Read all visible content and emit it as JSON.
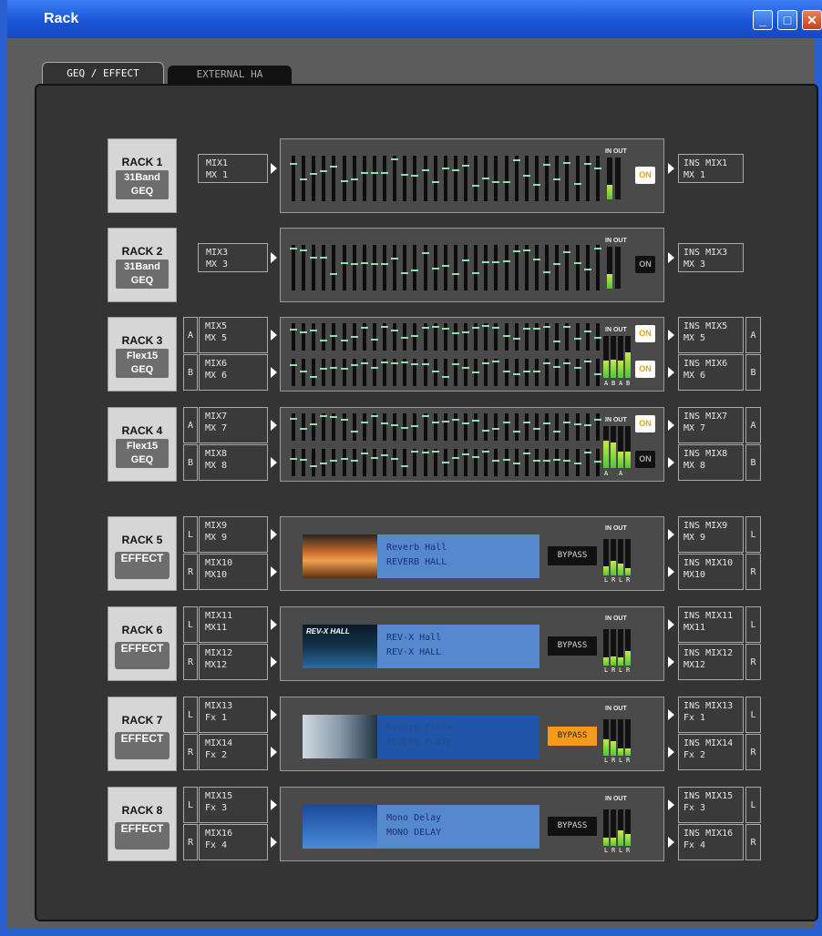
{
  "window": {
    "title": "Rack"
  },
  "tabs": [
    "GEQ / EFFECT",
    "EXTERNAL HA"
  ],
  "labels": {
    "in": "IN",
    "out": "OUT",
    "on": "ON",
    "bypass": "BYPASS"
  },
  "racks": [
    {
      "kind": "geq",
      "name": "RACK 1",
      "type": "31Band\nGEQ",
      "in": [
        [
          "MIX1",
          "MX 1"
        ]
      ],
      "out": [
        [
          "INS MIX1",
          "MX 1"
        ]
      ],
      "on": [
        true
      ]
    },
    {
      "kind": "geq",
      "name": "RACK 2",
      "type": "31Band\nGEQ",
      "in": [
        [
          "MIX3",
          "MX 3"
        ]
      ],
      "out": [
        [
          "INS MIX3",
          "MX 3"
        ]
      ],
      "on": [
        false
      ]
    },
    {
      "kind": "geq2",
      "name": "RACK 3",
      "type": "Flex15\nGEQ",
      "in": [
        [
          "MIX5",
          "MX 5"
        ],
        [
          "MIX6",
          "MX 6"
        ]
      ],
      "out": [
        [
          "INS MIX5",
          "MX 5"
        ],
        [
          "INS MIX6",
          "MX 6"
        ]
      ],
      "on": [
        true,
        true
      ],
      "ch": [
        "A",
        "B"
      ],
      "mlabels": "ABAB"
    },
    {
      "kind": "geq2",
      "name": "RACK 4",
      "type": "Flex15\nGEQ",
      "in": [
        [
          "MIX7",
          "MX 7"
        ],
        [
          "MIX8",
          "MX 8"
        ]
      ],
      "out": [
        [
          "INS MIX7",
          "MX 7"
        ],
        [
          "INS MIX8",
          "MX 8"
        ]
      ],
      "on": [
        true,
        false
      ],
      "ch": [
        "A",
        "B"
      ],
      "mlabels": "A A"
    },
    {
      "kind": "fx",
      "name": "RACK 5",
      "type": "EFFECT",
      "in": [
        [
          "MIX9",
          "MX 9"
        ],
        [
          "MIX10",
          "MX10"
        ]
      ],
      "out": [
        [
          "INS MIX9",
          "MX 9"
        ],
        [
          "INS MIX10",
          "MX10"
        ]
      ],
      "ch": [
        "L",
        "R"
      ],
      "preset": [
        "Reverb Hall",
        "REVERB HALL"
      ],
      "bypass": false,
      "thumb": "hall",
      "mlabels": "LRLR"
    },
    {
      "kind": "fx",
      "name": "RACK 6",
      "type": "EFFECT",
      "in": [
        [
          "MIX11",
          "MX11"
        ],
        [
          "MIX12",
          "MX12"
        ]
      ],
      "out": [
        [
          "INS MIX11",
          "MX11"
        ],
        [
          "INS MIX12",
          "MX12"
        ]
      ],
      "ch": [
        "L",
        "R"
      ],
      "preset": [
        "REV-X Hall",
        "REV-X HALL"
      ],
      "bypass": false,
      "thumb": "revx",
      "thumbText": "REV-X HALL",
      "mlabels": "LRLR"
    },
    {
      "kind": "fx",
      "name": "RACK 7",
      "type": "EFFECT",
      "in": [
        [
          "MIX13",
          "Fx 1"
        ],
        [
          "MIX14",
          "Fx 2"
        ]
      ],
      "out": [
        [
          "INS MIX13",
          "Fx 1"
        ],
        [
          "INS MIX14",
          "Fx 2"
        ]
      ],
      "ch": [
        "L",
        "R"
      ],
      "preset": [
        "Reverb Plate",
        "REVERB PLATE"
      ],
      "bypass": true,
      "thumb": "plate",
      "mlabels": "LRLR"
    },
    {
      "kind": "fx",
      "name": "RACK 8",
      "type": "EFFECT",
      "in": [
        [
          "MIX15",
          "Fx 3"
        ],
        [
          "MIX16",
          "Fx 4"
        ]
      ],
      "out": [
        [
          "INS MIX15",
          "Fx 3"
        ],
        [
          "INS MIX16",
          "Fx 4"
        ]
      ],
      "ch": [
        "L",
        "R"
      ],
      "preset": [
        "Mono Delay",
        "MONO DELAY"
      ],
      "bypass": false,
      "thumb": "delay",
      "mlabels": "LRLR"
    }
  ]
}
